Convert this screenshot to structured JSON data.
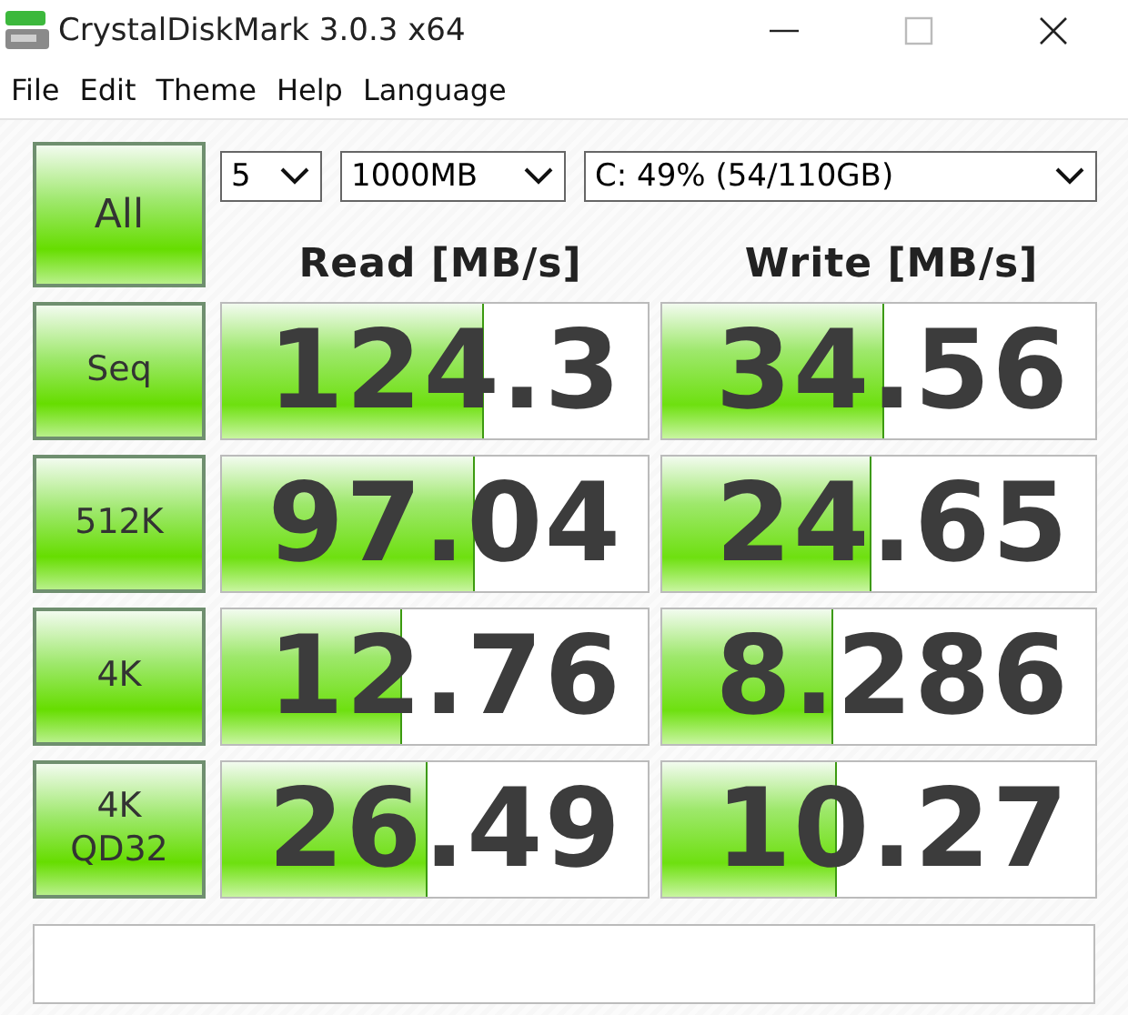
{
  "window": {
    "title": "CrystalDiskMark 3.0.3 x64"
  },
  "menu": [
    "File",
    "Edit",
    "Theme",
    "Help",
    "Language"
  ],
  "all_button": "All",
  "selects": [
    {
      "value": "5"
    },
    {
      "value": "1000MB"
    },
    {
      "value": "C: 49% (54/110GB)"
    }
  ],
  "columns": [
    "Read [MB/s]",
    "Write [MB/s]"
  ],
  "rows": [
    {
      "label": "Seq",
      "read": {
        "value": "124.3",
        "level": 0.61
      },
      "write": {
        "value": "34.56",
        "level": 0.51
      }
    },
    {
      "label": "512K",
      "read": {
        "value": "97.04",
        "level": 0.59
      },
      "write": {
        "value": "24.65",
        "level": 0.48
      }
    },
    {
      "label": "4K",
      "read": {
        "value": "12.76",
        "level": 0.42
      },
      "write": {
        "value": "8.286",
        "level": 0.39
      }
    },
    {
      "label": "4K QD32",
      "read": {
        "value": "26.49",
        "level": 0.48
      },
      "write": {
        "value": "10.27",
        "level": 0.4
      }
    }
  ]
}
